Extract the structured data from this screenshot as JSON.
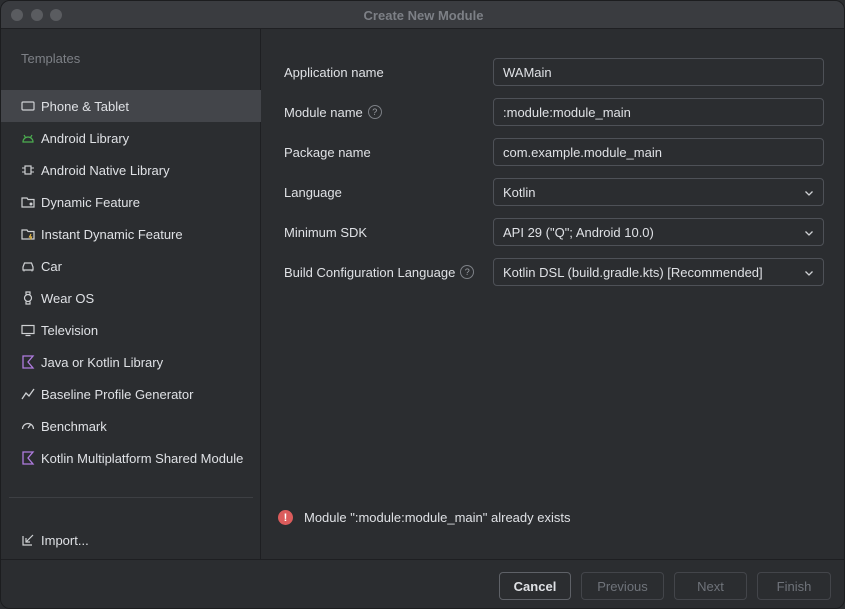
{
  "window": {
    "title": "Create New Module"
  },
  "sidebar": {
    "heading": "Templates",
    "items": [
      {
        "label": "Phone & Tablet",
        "icon": "phone-tablet-icon",
        "selected": true
      },
      {
        "label": "Android Library",
        "icon": "android-icon"
      },
      {
        "label": "Android Native Library",
        "icon": "native-library-icon"
      },
      {
        "label": "Dynamic Feature",
        "icon": "dynamic-feature-icon"
      },
      {
        "label": "Instant Dynamic Feature",
        "icon": "instant-dynamic-feature-icon"
      },
      {
        "label": "Car",
        "icon": "car-icon"
      },
      {
        "label": "Wear OS",
        "icon": "watch-icon"
      },
      {
        "label": "Television",
        "icon": "tv-icon"
      },
      {
        "label": "Java or Kotlin Library",
        "icon": "kotlin-icon"
      },
      {
        "label": "Baseline Profile Generator",
        "icon": "baseline-profile-icon"
      },
      {
        "label": "Benchmark",
        "icon": "benchmark-icon"
      },
      {
        "label": "Kotlin Multiplatform Shared Module",
        "icon": "kotlin-multiplatform-icon"
      }
    ],
    "import_label": "Import..."
  },
  "form": {
    "application_name": {
      "label": "Application name",
      "value": "WAMain"
    },
    "module_name": {
      "label": "Module name",
      "value": ":module:module_main"
    },
    "package_name": {
      "label": "Package name",
      "value": "com.example.module_main"
    },
    "language": {
      "label": "Language",
      "value": "Kotlin"
    },
    "minimum_sdk": {
      "label": "Minimum SDK",
      "value": "API 29 (\"Q\"; Android 10.0)"
    },
    "build_config_language": {
      "label": "Build Configuration Language",
      "value": "Kotlin DSL (build.gradle.kts) [Recommended]"
    },
    "help_glyph": "?"
  },
  "error": {
    "icon_glyph": "!",
    "message": "Module \":module:module_main\" already exists"
  },
  "footer": {
    "cancel": "Cancel",
    "previous": "Previous",
    "next": "Next",
    "finish": "Finish"
  },
  "colors": {
    "background": "#2b2d30",
    "selected": "#43454a",
    "error": "#db5c5c",
    "kotlin_accent": "#b07ce0",
    "android_accent": "#4caf50"
  }
}
